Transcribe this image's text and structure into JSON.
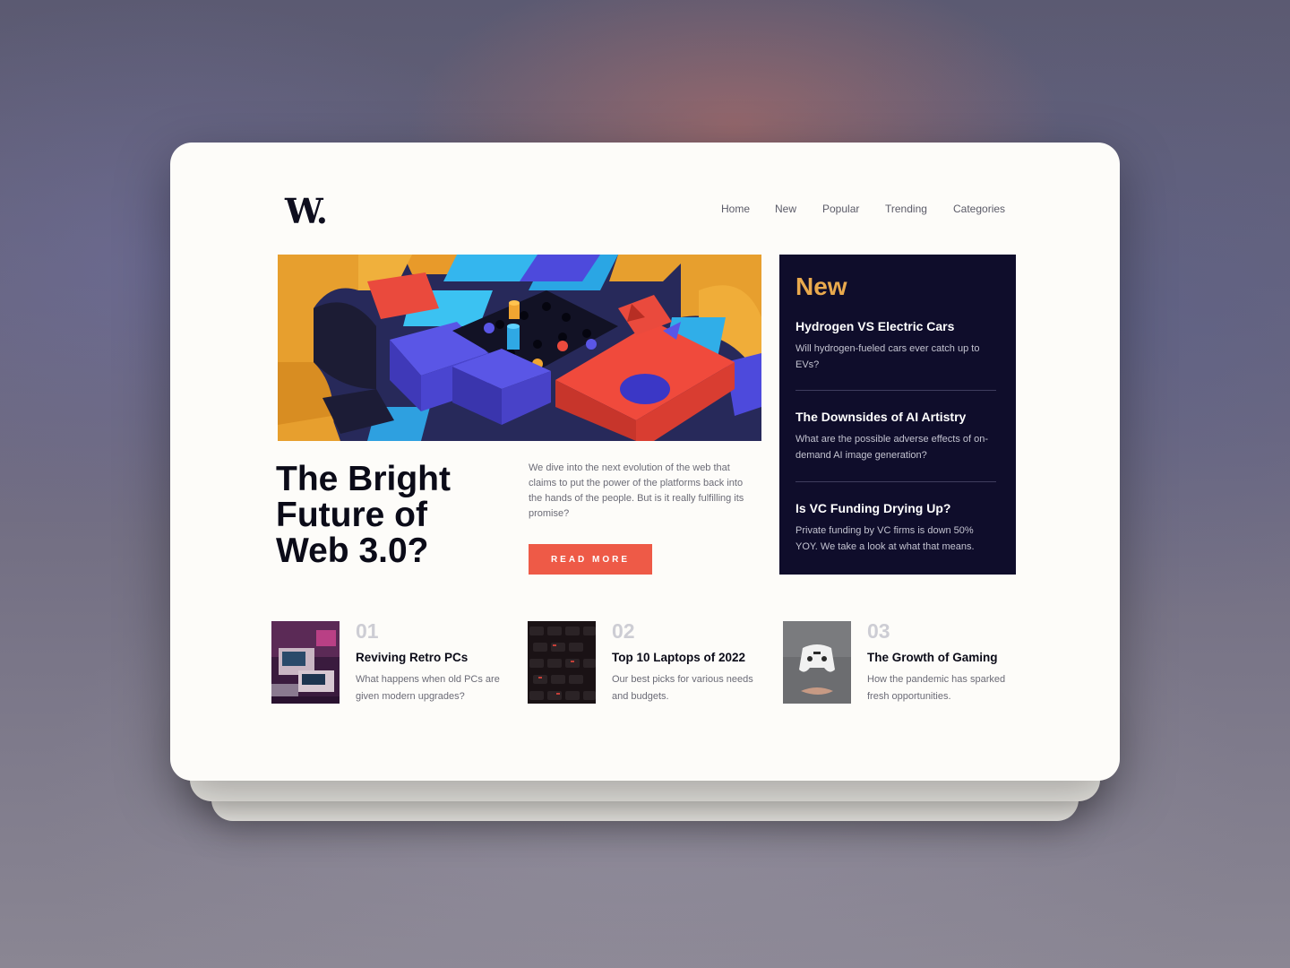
{
  "brand": {
    "logo_text": "W."
  },
  "nav": {
    "items": [
      "Home",
      "New",
      "Popular",
      "Trending",
      "Categories"
    ]
  },
  "hero": {
    "title_lines": [
      "The Bright",
      "Future of",
      "Web 3.0?"
    ],
    "description": "We dive into the next evolution of the web that claims to put the power of the platforms back into the hands of the people. But is it really fulfilling its promise?",
    "button_label": "READ MORE"
  },
  "new_panel": {
    "heading": "New",
    "items": [
      {
        "title": "Hydrogen VS Electric Cars",
        "desc": "Will hydrogen-fueled cars ever catch up to EVs?"
      },
      {
        "title": "The Downsides of AI Artistry",
        "desc": "What are the possible adverse effects of on-demand AI image generation?"
      },
      {
        "title": "Is VC Funding Drying Up?",
        "desc": "Private funding by VC firms is down 50% YOY. We take a look at what that means."
      }
    ]
  },
  "bottom": {
    "items": [
      {
        "num": "01",
        "title": "Reviving Retro PCs",
        "desc": "What happens when old PCs are given modern upgrades?"
      },
      {
        "num": "02",
        "title": "Top 10 Laptops of 2022",
        "desc": "Our best picks for various needs and budgets."
      },
      {
        "num": "03",
        "title": "The Growth of Gaming",
        "desc": "How the pandemic has sparked fresh opportunities."
      }
    ]
  },
  "colors": {
    "accent_orange": "#e9a94d",
    "button_red": "#ee5a47",
    "panel_navy": "#0f0d2b",
    "text_dark": "#0b0b18"
  }
}
